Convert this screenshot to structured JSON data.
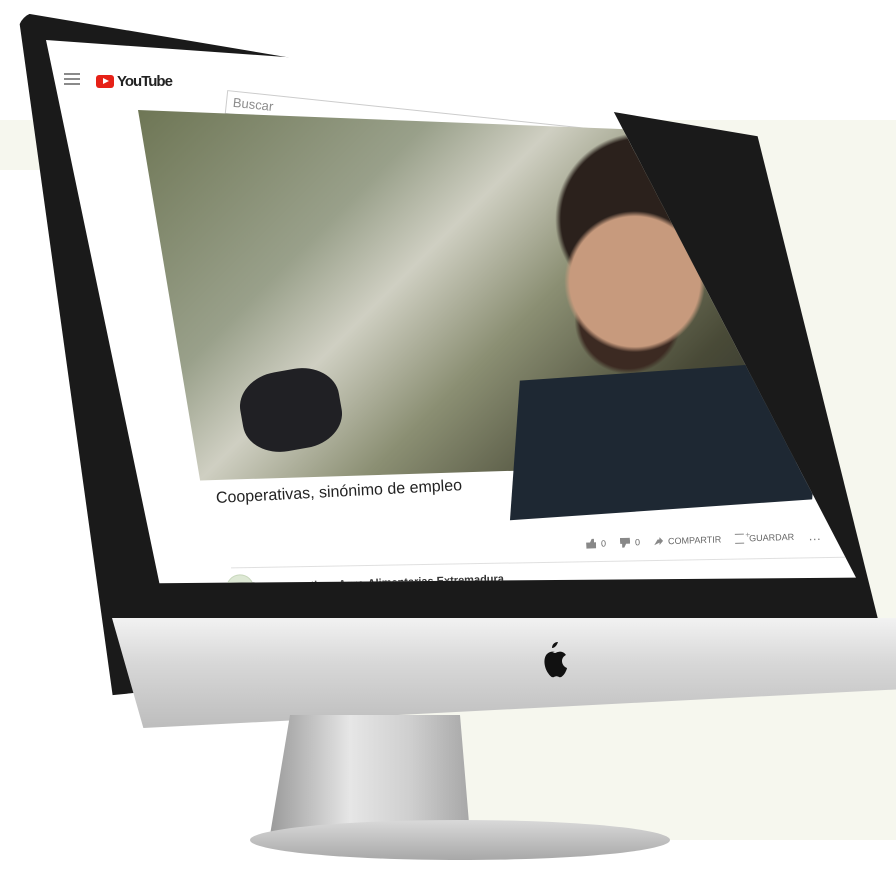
{
  "youtube": {
    "brand": "YouTube",
    "search_placeholder": "Buscar",
    "video_title": "Cooperativas, sinónimo de empleo",
    "likes": "0",
    "dislikes": "0",
    "share_label": "COMPARTIR",
    "save_label": "GUARDAR",
    "channel_name": "Cooperativas Agro-Alimentarias Extremadura"
  },
  "colors": {
    "accent_red": "#e62117",
    "subscribe_red": "#d92b24",
    "background_green": "#f6f7ee"
  },
  "icons": {
    "menu": "hamburger-menu-icon",
    "search": "search-icon",
    "like": "thumb-up-icon",
    "dislike": "thumb-down-icon",
    "share": "share-arrow-icon",
    "save": "playlist-add-icon",
    "more": "more-dots-icon",
    "apple": "apple-logo-icon"
  }
}
